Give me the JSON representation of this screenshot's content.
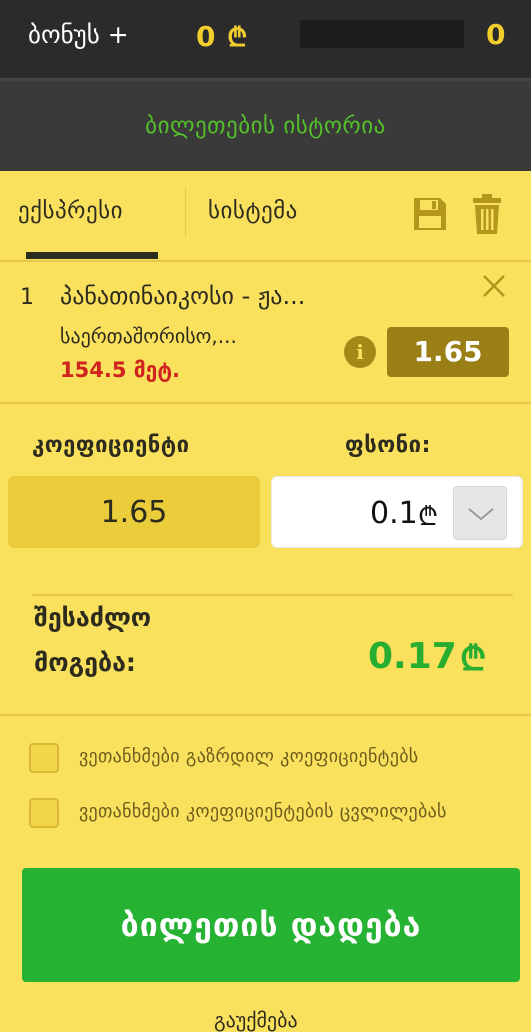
{
  "topbar": {
    "bonus_label": "ბონუს +",
    "bonus_amount": "0",
    "currency_symbol": "₾",
    "count": "0"
  },
  "history": {
    "label": "ბილეთების ისტორია"
  },
  "tabs": [
    {
      "label": "ექსპრესი",
      "active": true
    },
    {
      "label": "სისტემა",
      "active": false
    }
  ],
  "icons": {
    "save": "save-icon",
    "trash": "trash-icon",
    "close": "close-icon",
    "info": "info-icon",
    "dropdown": "chevron-down-icon"
  },
  "bet": {
    "index": "1",
    "title": "პანათინაიკოსი - ჟა...",
    "market": "საერთაშორისო,...",
    "outcome": "154.5 მეტ.",
    "odd": "1.65",
    "info_glyph": "i"
  },
  "stake_section": {
    "coef_label": "კოეფიციენტი",
    "stake_label": "ფსონი:",
    "coef_value": "1.65",
    "stake_value": "0.1"
  },
  "win": {
    "label_line1": "შესაძლო",
    "label_line2": "მოგება:",
    "value": "0.17"
  },
  "checkboxes": [
    {
      "label": "ვეთანხმები გაზრდილ კოეფიციენტებს",
      "checked": false
    },
    {
      "label": "ვეთანხმები კოეფიციენტების ცვლილებას",
      "checked": false
    }
  ],
  "place_bet": {
    "label": "ბილეთის დადება"
  },
  "bottom_link": "გაუქმება",
  "colors": {
    "accent_green": "#26b232",
    "background_yellow": "#f9e05d",
    "topbar": "#2b2b2b",
    "outcome_red": "#d0221e"
  }
}
